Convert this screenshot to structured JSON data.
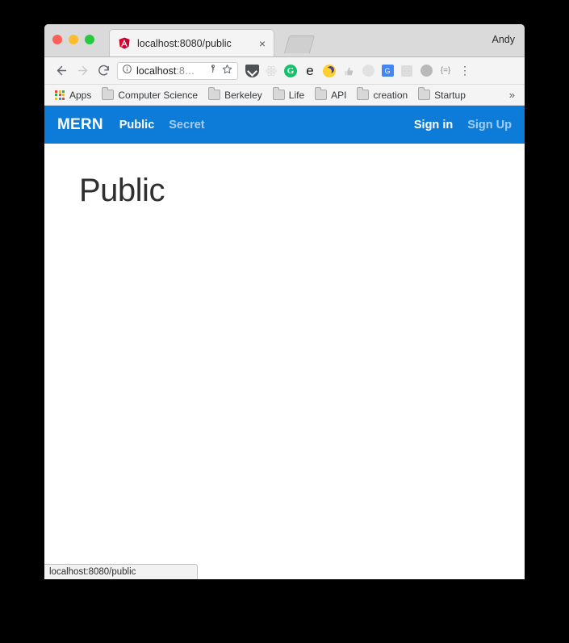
{
  "window": {
    "profile_name": "Andy",
    "traffic_lights": [
      "close",
      "minimize",
      "maximize"
    ]
  },
  "tab": {
    "title": "localhost:8080/public",
    "favicon": "angular-icon",
    "close_label": "×",
    "new_tab_label": "new-tab"
  },
  "toolbar": {
    "back_label": "←",
    "forward_label": "→",
    "reload_label": "⟳",
    "omnibox": {
      "info_icon": "ⓘ",
      "url_visible": "localhost",
      "url_truncated": ":8…",
      "full_url": "localhost:8080/public",
      "key_icon": "key-icon",
      "star_icon": "☆"
    },
    "extensions": [
      {
        "name": "pocket-shield-extension",
        "glyph": ""
      },
      {
        "name": "react-devtools-extension",
        "glyph": "⚛"
      },
      {
        "name": "grammarly-extension",
        "glyph": "G"
      },
      {
        "name": "evernote-extension",
        "glyph": "e"
      },
      {
        "name": "night-mode-extension",
        "glyph": ""
      },
      {
        "name": "thumb-extension",
        "glyph": "☝"
      },
      {
        "name": "momentum-extension",
        "glyph": ""
      },
      {
        "name": "google-translate-extension",
        "glyph": "G"
      },
      {
        "name": "grey-square-extension",
        "glyph": ""
      },
      {
        "name": "metamask-extension",
        "glyph": ""
      },
      {
        "name": "json-formatter-extension",
        "glyph": "{=}"
      }
    ],
    "menu_label": "⋮"
  },
  "bookmarks": {
    "apps_label": "Apps",
    "items": [
      {
        "label": "Computer Science"
      },
      {
        "label": "Berkeley"
      },
      {
        "label": "Life"
      },
      {
        "label": "API"
      },
      {
        "label": "creation"
      },
      {
        "label": "Startup"
      }
    ],
    "overflow_label": "»"
  },
  "navbar": {
    "brand": "MERN",
    "links": [
      {
        "label": "Public",
        "active": true
      },
      {
        "label": "Secret",
        "active": false
      }
    ],
    "auth": [
      {
        "label": "Sign in",
        "active": true
      },
      {
        "label": "Sign Up",
        "active": false
      }
    ],
    "background_color": "#0d7cd9"
  },
  "main": {
    "heading": "Public"
  },
  "status_bar": {
    "text": "localhost:8080/public"
  }
}
